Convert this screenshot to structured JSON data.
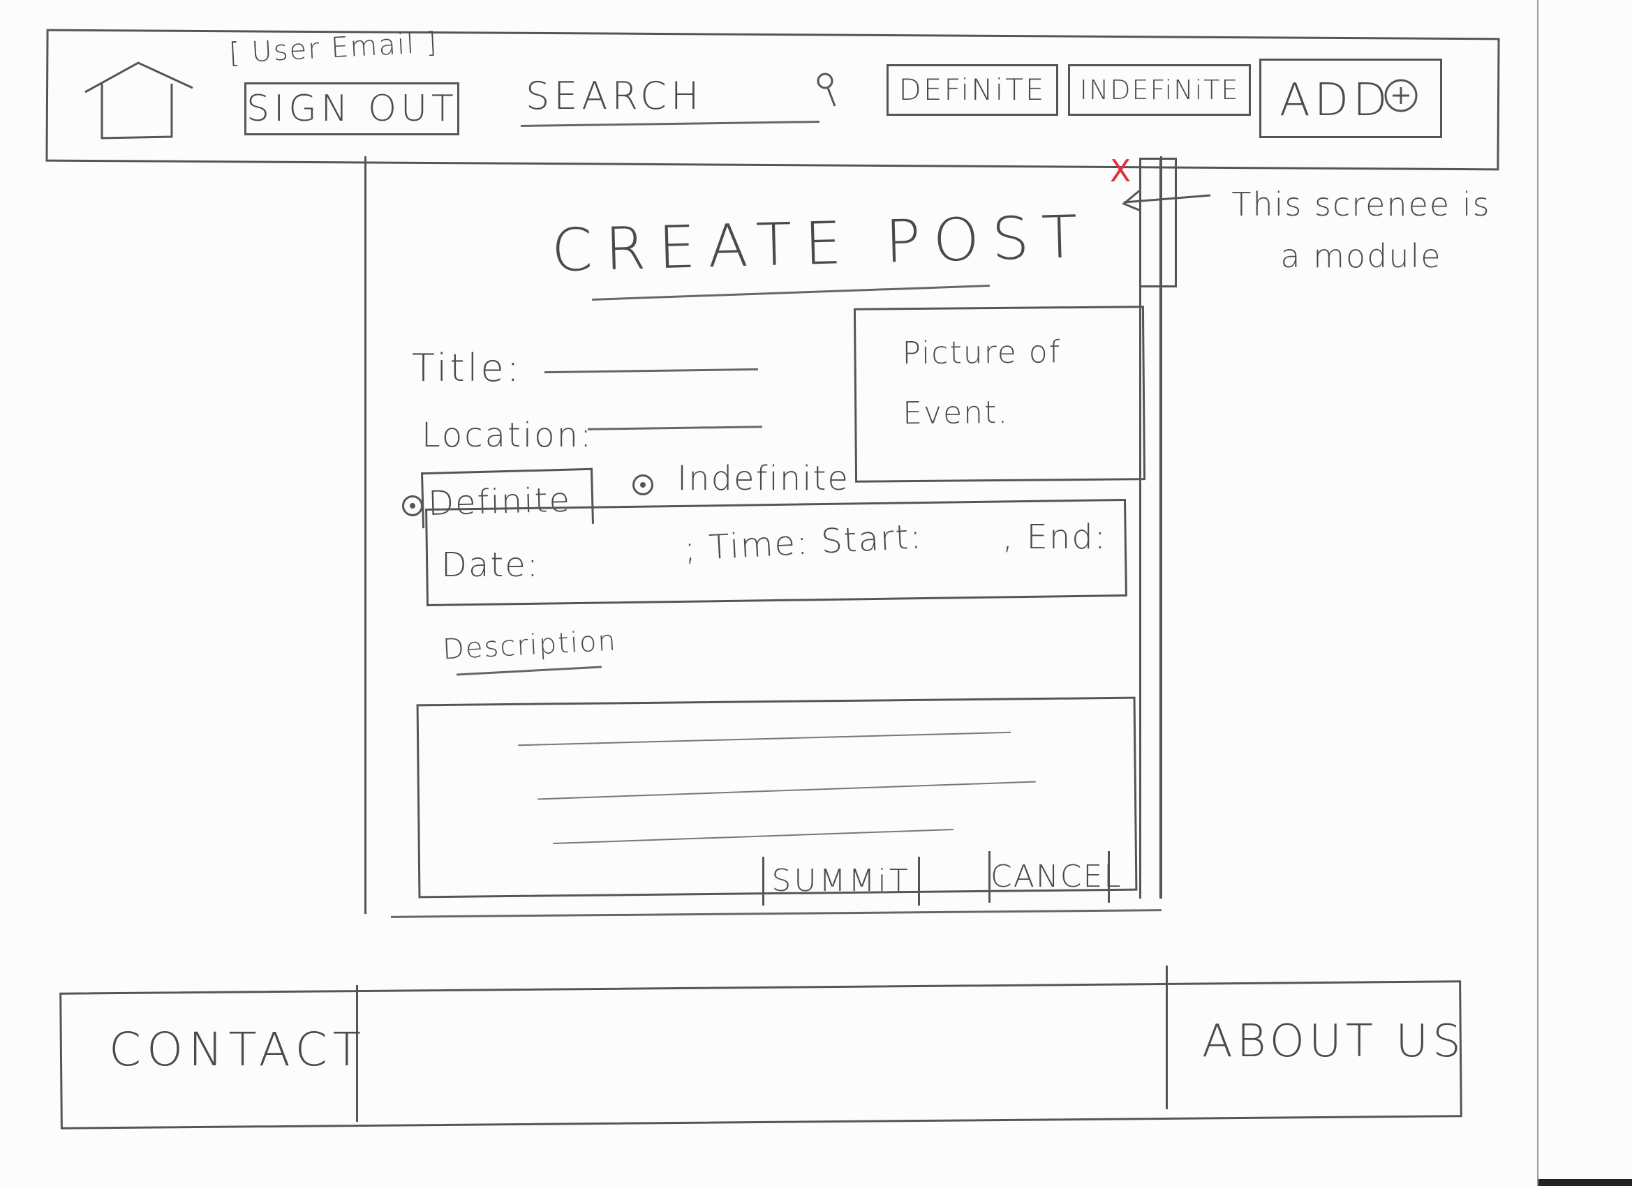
{
  "header": {
    "user_email": "[ User Email ]",
    "sign_out_label": "SIGN OUT",
    "search_label": "SEARCH",
    "definite_label": "DEFiNiTE",
    "indefinite_label": "INDEFiNiTE",
    "add_label": "ADD"
  },
  "modal": {
    "title": "CREATE POST",
    "title_field_label": "Title:",
    "location_field_label": "Location:",
    "picture_label": "Picture of Event.",
    "tab_definite_label": "Definite",
    "tab_indefinite_label": "Indefinite",
    "date_label": "Date:",
    "time_label": "; Time: Start:",
    "end_label": ", End:",
    "description_label": "Description",
    "submit_label": "SUMMiT",
    "cancel_label": "CANCEL",
    "close_glyph": "X"
  },
  "annotation": {
    "note": "This screnee is a module"
  },
  "footer": {
    "contact_label": "CONTACT",
    "about_label": "ABOUT US"
  },
  "colors": {
    "pencil": "#555555",
    "close_x": "#e03040"
  },
  "icons": {
    "home": "house-icon",
    "search": "magnifier-icon",
    "add": "plus-circle-icon",
    "close": "close-icon"
  }
}
